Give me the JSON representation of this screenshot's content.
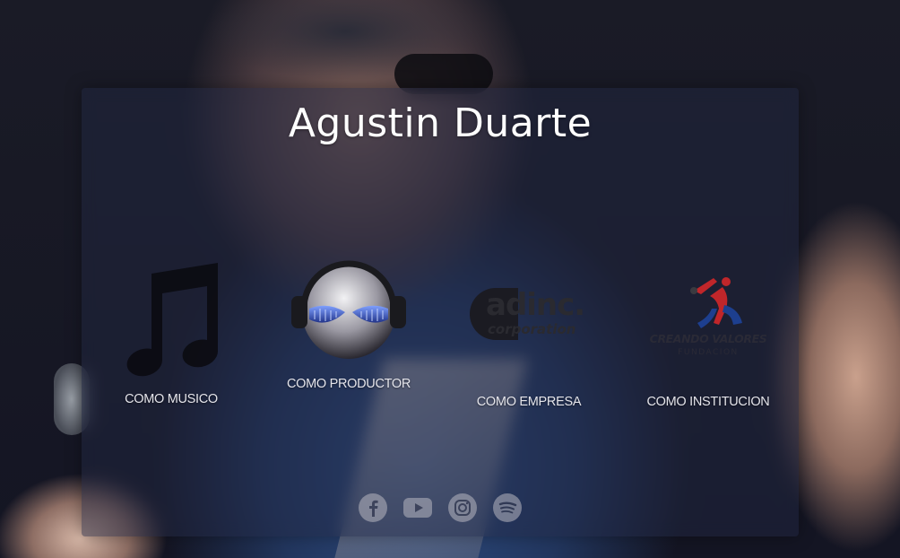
{
  "page": {
    "title": "Agustin Duarte"
  },
  "roles": [
    {
      "id": "musico",
      "label": "COMO MUSICO",
      "icon": "music-note-icon"
    },
    {
      "id": "productor",
      "label": "COMO PRODUCTOR",
      "icon": "dj-headphones-icon"
    },
    {
      "id": "empresa",
      "label": "COMO EMPRESA",
      "icon": "adinc-logo"
    },
    {
      "id": "institucion",
      "label": "COMO INSTITUCION",
      "icon": "creando-valores-logo"
    }
  ],
  "logos": {
    "adinc_main": "adinc.",
    "adinc_sub": "corporation",
    "fundacion_main": "CREANDO VALORES",
    "fundacion_sub": "FUNDACION"
  },
  "social": [
    {
      "name": "facebook",
      "icon": "facebook-icon"
    },
    {
      "name": "youtube",
      "icon": "youtube-icon"
    },
    {
      "name": "instagram",
      "icon": "instagram-icon"
    },
    {
      "name": "spotify",
      "icon": "spotify-icon"
    }
  ],
  "colors": {
    "title": "#ffffff",
    "label": "#e4e4ea",
    "card": "#222842",
    "fundacion_red": "#c0262a",
    "fundacion_blue": "#1d3f8f"
  }
}
